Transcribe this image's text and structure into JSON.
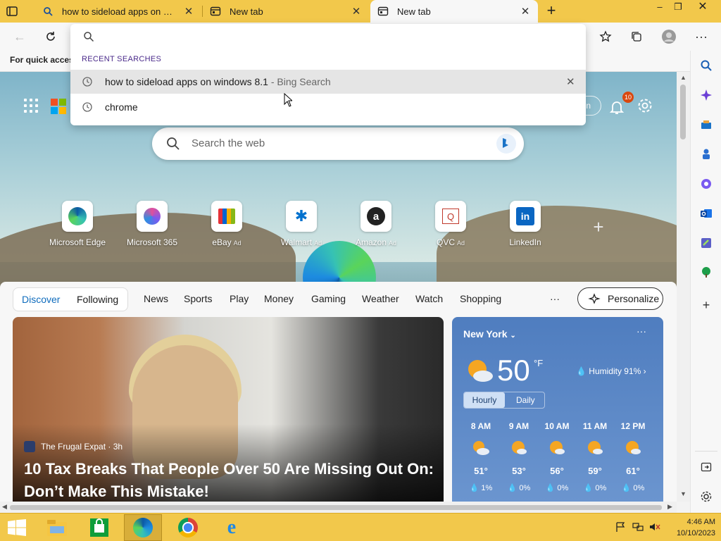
{
  "browser": {
    "tabs": [
      {
        "title": "how to sideload apps on windows 8.1 - Bing Search",
        "icon": "search-icon",
        "active": false
      },
      {
        "title": "New tab",
        "icon": "newtab-page-icon",
        "active": false
      },
      {
        "title": "New tab",
        "icon": "newtab-page-icon",
        "active": true
      }
    ],
    "window_controls": {
      "minimize": "–",
      "maximize": "❐",
      "close": "✕"
    }
  },
  "address_dropdown": {
    "query": "",
    "header": "RECENT SEARCHES",
    "suggestions": [
      {
        "text": "how to sideload apps on windows 8.1",
        "sub": " - Bing Search",
        "highlighted": true
      },
      {
        "text": "chrome",
        "sub": "",
        "highlighted": false
      }
    ]
  },
  "favorites_bar": {
    "text": "For quick access"
  },
  "newtab": {
    "signin": "n",
    "notifications_count": "10",
    "search_placeholder": "Search the web",
    "quick_links": [
      {
        "label": "Microsoft Edge",
        "ad": ""
      },
      {
        "label": "Microsoft 365",
        "ad": ""
      },
      {
        "label": "eBay",
        "ad": "Ad"
      },
      {
        "label": "Walmart",
        "ad": "Ad"
      },
      {
        "label": "Amazon",
        "ad": "Ad"
      },
      {
        "label": "QVC",
        "ad": "Ad"
      },
      {
        "label": "LinkedIn",
        "ad": ""
      }
    ],
    "feed_tabs": [
      "Discover",
      "Following"
    ],
    "feed_nav": [
      "News",
      "Sports",
      "Play",
      "Money",
      "Gaming",
      "Weather",
      "Watch",
      "Shopping",
      "···"
    ],
    "personalize": "Personalize"
  },
  "hero_article": {
    "source": "The Frugal Expat · 3h",
    "headline": "10 Tax Breaks That People Over 50 Are Missing Out On: Don’t Make This Mistake!"
  },
  "weather": {
    "city": "New York",
    "more": "···",
    "temp": "50",
    "unit": "°F",
    "humidity": "Humidity 91%",
    "modes": [
      "Hourly",
      "Daily"
    ],
    "hours": [
      {
        "time": "8 AM",
        "temp": "51°",
        "precip": "1%"
      },
      {
        "time": "9 AM",
        "temp": "53°",
        "precip": "0%"
      },
      {
        "time": "10 AM",
        "temp": "56°",
        "precip": "0%"
      },
      {
        "time": "11 AM",
        "temp": "59°",
        "precip": "0%"
      },
      {
        "time": "12 PM",
        "temp": "61°",
        "precip": "0%"
      }
    ]
  },
  "taskbar": {
    "apps": [
      "file-explorer",
      "windows-store",
      "microsoft-edge",
      "google-chrome",
      "internet-explorer"
    ],
    "time": "4:46 AM",
    "date": "10/10/2023"
  },
  "colors": {
    "title_bar": "#f2c84b",
    "taskbar": "#f2c84b",
    "accent": "#0f6cbd",
    "badge": "#d9480f"
  }
}
